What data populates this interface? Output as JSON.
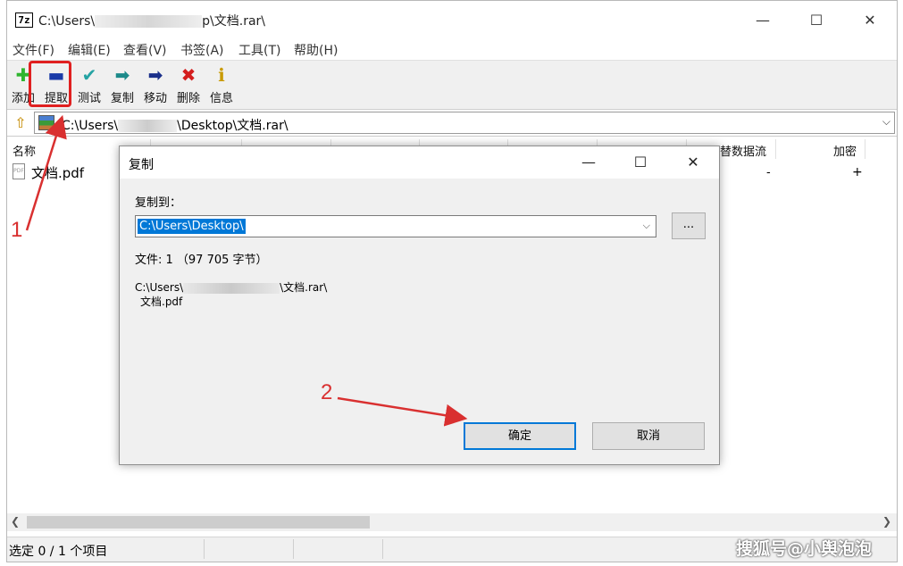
{
  "window": {
    "icon_text": "7z",
    "title_prefix": "C:\\Users\\",
    "title_suffix": "p\\文档.rar\\",
    "minimize": "—",
    "maximize": "☐",
    "close": "✕"
  },
  "menu": [
    "文件(F)",
    "编辑(E)",
    "查看(V)",
    "书签(A)",
    "工具(T)",
    "帮助(H)"
  ],
  "toolbar": [
    {
      "label": "添加",
      "icon": "add-icon",
      "glyph": "✚",
      "color": "#2fb52f"
    },
    {
      "label": "提取",
      "icon": "extract-icon",
      "glyph": "▬",
      "color": "#1a3aa8"
    },
    {
      "label": "测试",
      "icon": "test-icon",
      "glyph": "✔",
      "color": "#24a3a3"
    },
    {
      "label": "复制",
      "icon": "copy-icon",
      "glyph": "➡",
      "color": "#1c8a8a"
    },
    {
      "label": "移动",
      "icon": "move-icon",
      "glyph": "➡",
      "color": "#1a2f8a"
    },
    {
      "label": "删除",
      "icon": "delete-icon",
      "glyph": "✖",
      "color": "#d41e1e"
    },
    {
      "label": "信息",
      "icon": "info-icon",
      "glyph": "ℹ",
      "color": "#c99a00"
    }
  ],
  "address": {
    "prefix": "C:\\Users\\",
    "suffix": "\\Desktop\\文档.rar\\",
    "dropdown": "⌵"
  },
  "list": {
    "columns": {
      "name": "名称",
      "alt_streams": "替数据流",
      "encrypted": "加密"
    },
    "rows": [
      {
        "name": "文档.pdf",
        "alt_streams": "-",
        "encrypted": "+"
      }
    ]
  },
  "status": {
    "selection": "选定 0 / 1 个项目"
  },
  "watermark": "搜狐号@小舆泡泡",
  "dialog": {
    "title": "复制",
    "minimize": "—",
    "maximize": "☐",
    "close": "✕",
    "copy_to_label": "复制到：",
    "destination": "C:\\Users\\Desktop\\",
    "browse": "...",
    "file_info": "文件: 1 （97 705 字节）",
    "path_prefix": "C:\\Users\\",
    "path_suffix": "\\文档.rar\\",
    "file_name": "文档.pdf",
    "ok": "确定",
    "cancel": "取消"
  },
  "annotations": {
    "step1": "1",
    "step2": "2",
    "color": "#d93030"
  }
}
